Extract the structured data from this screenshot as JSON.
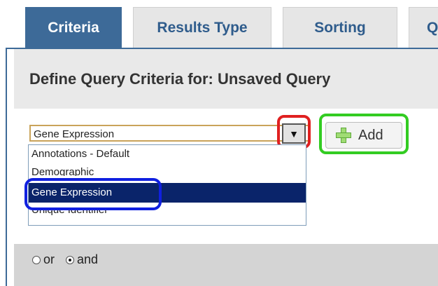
{
  "tabs": [
    {
      "label": "Criteria",
      "active": true
    },
    {
      "label": "Results Type",
      "active": false
    },
    {
      "label": "Sorting",
      "active": false
    },
    {
      "label": "Q",
      "active": false
    }
  ],
  "panel": {
    "title": "Define Query Criteria for: Unsaved Query"
  },
  "criteria_select": {
    "value": "Gene Expression",
    "options": [
      "Annotations - Default",
      "Demographic",
      "Gene Expression",
      "Unique Identifier"
    ],
    "highlighted_index": 2
  },
  "add_button": {
    "label": "Add",
    "icon": "plus-icon"
  },
  "logic": {
    "or_label": "or",
    "and_label": "and",
    "selected": "and"
  },
  "colors": {
    "tab_active": "#3d6a98",
    "annotation_red": "#e02020",
    "annotation_green": "#33cc22",
    "annotation_blue": "#1020e0",
    "selection": "#0a246a"
  }
}
